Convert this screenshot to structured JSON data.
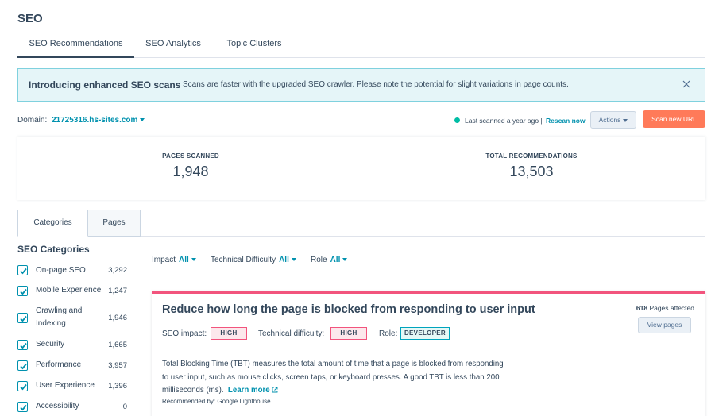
{
  "page": {
    "title": "SEO"
  },
  "tabs": [
    {
      "label": "SEO Recommendations"
    },
    {
      "label": "SEO Analytics"
    },
    {
      "label": "Topic Clusters"
    }
  ],
  "banner": {
    "title": "Introducing enhanced SEO scans",
    "text": "Scans are faster with the upgraded SEO crawler. Please note the potential for slight variations in page counts."
  },
  "domain": {
    "label": "Domain:",
    "value": "21725316.hs-sites.com",
    "scan_status": "Last scanned a year ago",
    "separator": "|",
    "rescan_label": "Rescan now",
    "actions_label": "Actions",
    "scan_new_label": "Scan new URL"
  },
  "stats": {
    "pages_label": "PAGES SCANNED",
    "pages_value": "1,948",
    "recs_label": "TOTAL RECOMMENDATIONS",
    "recs_value": "13,503"
  },
  "sub_tabs": [
    {
      "label": "Categories"
    },
    {
      "label": "Pages"
    }
  ],
  "categories": {
    "title": "SEO Categories",
    "items": [
      {
        "name": "On-page SEO",
        "count": "3,292"
      },
      {
        "name": "Mobile Experience",
        "count": "1,247"
      },
      {
        "name": "Crawling and Indexing",
        "count": "1,946"
      },
      {
        "name": "Security",
        "count": "1,665"
      },
      {
        "name": "Performance",
        "count": "3,957"
      },
      {
        "name": "User Experience",
        "count": "1,396"
      },
      {
        "name": "Accessibility",
        "count": "0"
      }
    ]
  },
  "filters": {
    "impact_label": "Impact",
    "impact_value": "All",
    "difficulty_label": "Technical Difficulty",
    "difficulty_value": "All",
    "role_label": "Role",
    "role_value": "All"
  },
  "recommendation": {
    "title": "Reduce how long the page is blocked from responding to user input",
    "pages_count": "618",
    "pages_suffix": "Pages affected",
    "view_pages_label": "View pages",
    "impact_label": "SEO impact:",
    "impact_value": "HIGH",
    "difficulty_label": "Technical difficulty:",
    "difficulty_value": "HIGH",
    "role_label": "Role:",
    "role_value": "DEVELOPER",
    "description": "Total Blocking Time (TBT) measures the total amount of time that a page is blocked from responding to user input, such as mouse clicks, screen taps, or keyboard presses. A good TBT is less than 200 milliseconds (ms).",
    "learn_more": "Learn more",
    "recommended_by": "Recommended by: Google Lighthouse"
  },
  "colors": {
    "accent_link": "#0091ae",
    "primary_button": "#ff7a59",
    "status_dot": "#00bda5",
    "card_top_border": "#f2547d"
  }
}
